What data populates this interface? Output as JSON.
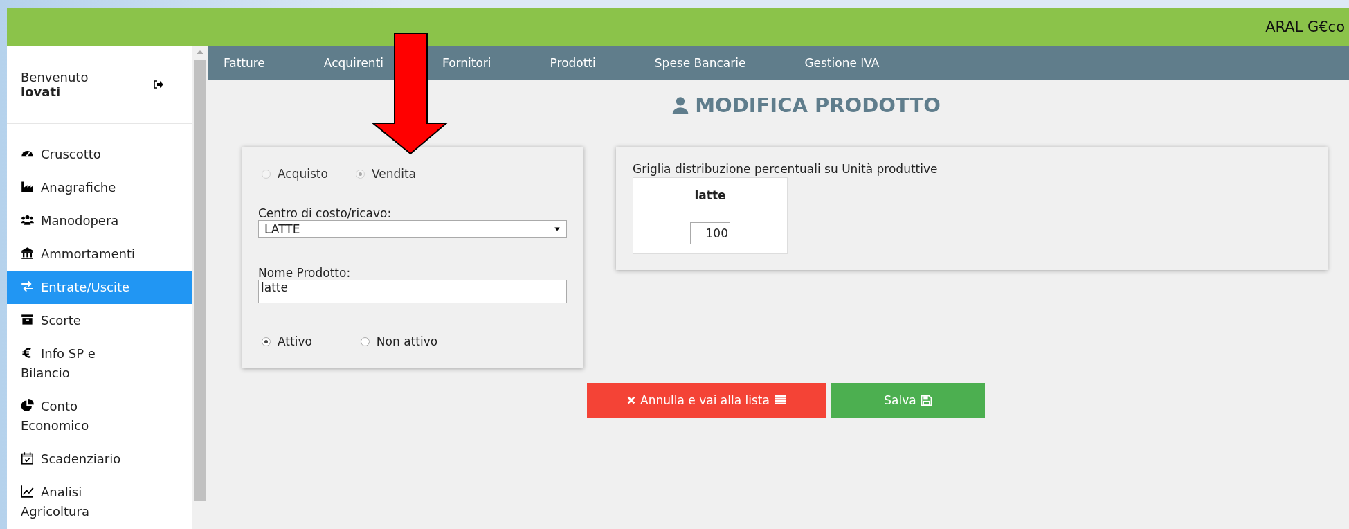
{
  "header": {
    "brand": "ARAL G€co"
  },
  "sidebar": {
    "welcome": "Benvenuto",
    "user": "lovati",
    "items": [
      {
        "label": "Cruscotto",
        "selected": false
      },
      {
        "label": "Anagrafiche",
        "selected": false
      },
      {
        "label": "Manodopera",
        "selected": false
      },
      {
        "label": "Ammortamenti",
        "selected": false
      },
      {
        "label": "Entrate/Uscite",
        "selected": true
      },
      {
        "label": "Scorte",
        "selected": false
      },
      {
        "label": "Info SP e Bilancio",
        "selected": false
      },
      {
        "label": "Conto Economico",
        "selected": false
      },
      {
        "label": "Scadenziario",
        "selected": false
      },
      {
        "label": "Analisi Agricoltura",
        "selected": false
      }
    ]
  },
  "nav": [
    "Fatture",
    "Acquirenti",
    "Fornitori",
    "Prodotti",
    "Spese Bancarie",
    "Gestione IVA"
  ],
  "title": "MODIFICA PRODOTTO",
  "form": {
    "type_options": {
      "disabled": true,
      "options": [
        {
          "label": "Acquisto",
          "selected": false
        },
        {
          "label": "Vendita",
          "selected": true
        }
      ]
    },
    "cost_center": {
      "label": "Centro di costo/ricavo:",
      "value": "LATTE"
    },
    "product_name": {
      "label": "Nome Prodotto:",
      "value": "latte"
    },
    "status_options": {
      "options": [
        {
          "label": "Attivo",
          "selected": true
        },
        {
          "label": "Non attivo",
          "selected": false
        }
      ]
    }
  },
  "grid": {
    "title": "Griglia distribuzione percentuali su Unità produttive",
    "columns": [
      "latte"
    ],
    "values": [
      "100"
    ]
  },
  "buttons": [
    {
      "label": "Annulla e vai alla lista",
      "kind": "cancel"
    },
    {
      "label": "Salva",
      "kind": "save"
    }
  ]
}
